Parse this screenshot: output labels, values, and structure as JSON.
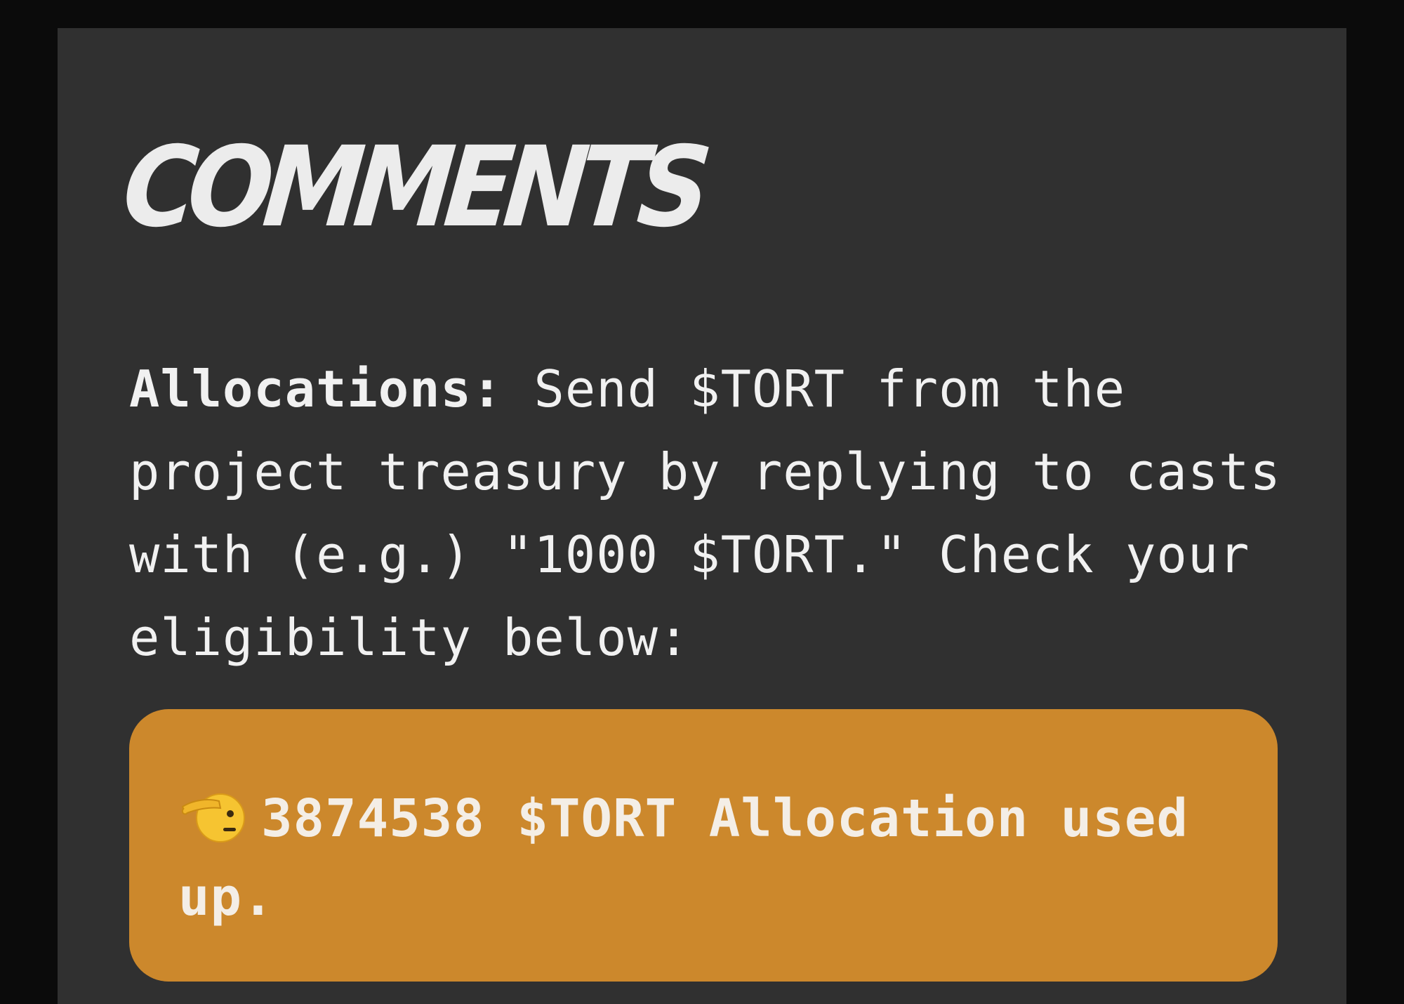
{
  "comments": {
    "title": "COMMENTS",
    "allocations_label": "Allocations:",
    "allocations_text": "Send $TORT from the project treasury by replying to casts with (e.g.) \"1000 $TORT.\" Check your eligibility below:",
    "status": {
      "icon": "saluting-face-icon",
      "message": "3874538 $TORT Allocation used up."
    }
  },
  "colors": {
    "page_background": "#0b0b0b",
    "panel_background": "#303030",
    "status_card": "#cc882c",
    "text": "#f1f1f1"
  }
}
